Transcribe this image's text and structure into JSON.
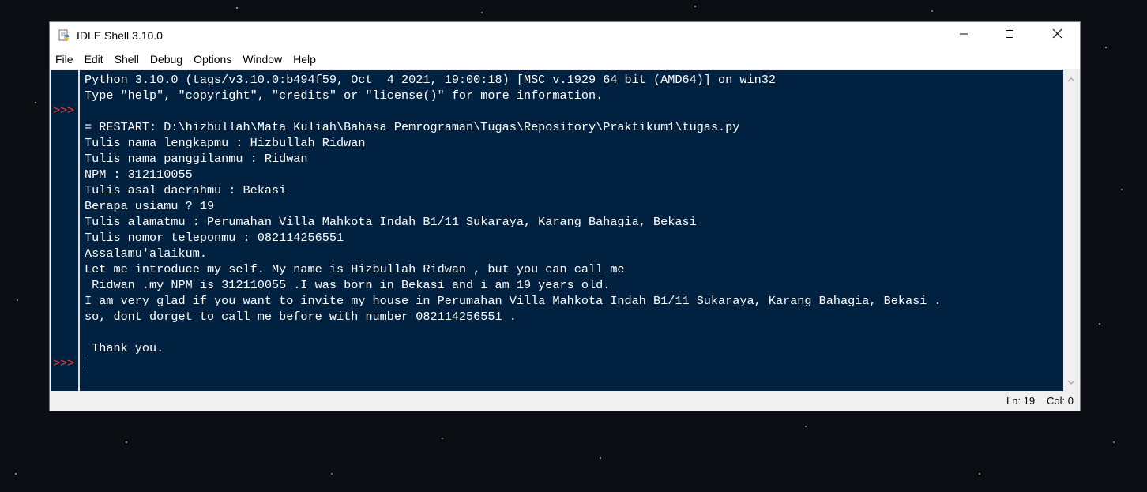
{
  "window": {
    "title": "IDLE Shell 3.10.0",
    "icon": "python-idle-icon"
  },
  "controls": {
    "minimize_icon": "minimize-icon",
    "maximize_icon": "maximize-icon",
    "close_icon": "close-icon"
  },
  "menu": {
    "items": [
      "File",
      "Edit",
      "Shell",
      "Debug",
      "Options",
      "Window",
      "Help"
    ]
  },
  "shell": {
    "prompt": ">>>",
    "lines": [
      "Python 3.10.0 (tags/v3.10.0:b494f59, Oct  4 2021, 19:00:18) [MSC v.1929 64 bit (AMD64)] on win32",
      "Type \"help\", \"copyright\", \"credits\" or \"license()\" for more information.",
      "",
      "= RESTART: D:\\hizbullah\\Mata Kuliah\\Bahasa Pemrograman\\Tugas\\Repository\\Praktikum1\\tugas.py",
      "Tulis nama lengkapmu : Hizbullah Ridwan",
      "Tulis nama panggilanmu : Ridwan",
      "NPM : 312110055",
      "Tulis asal daerahmu : Bekasi",
      "Berapa usiamu ? 19",
      "Tulis alamatmu : Perumahan Villa Mahkota Indah B1/11 Sukaraya, Karang Bahagia, Bekasi",
      "Tulis nomor teleponmu : 082114256551",
      "Assalamu'alaikum.",
      "Let me introduce my self. My name is Hizbullah Ridwan , but you can call me",
      " Ridwan .my NPM is 312110055 .I was born in Bekasi and i am 19 years old.",
      "I am very glad if you want to invite my house in Perumahan Villa Mahkota Indah B1/11 Sukaraya, Karang Bahagia, Bekasi .",
      "so, dont dorget to call me before with number 082114256551 .",
      "",
      " Thank you.",
      ""
    ]
  },
  "status": {
    "ln": "Ln: 19",
    "col": "Col: 0"
  },
  "colors": {
    "editor_bg": "#002240",
    "text": "#ffffff",
    "prompt": "#ff3b3b"
  }
}
